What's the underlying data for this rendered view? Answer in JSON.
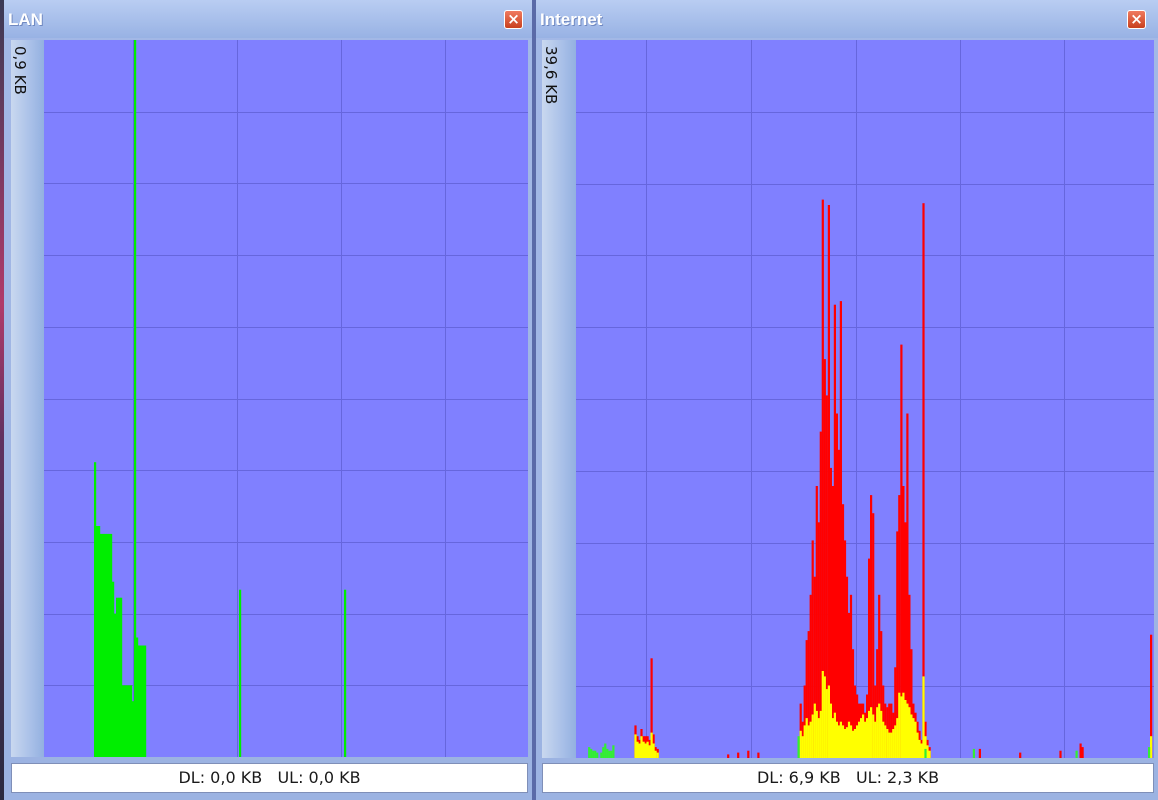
{
  "colors": {
    "graph_bg": "#8080ff",
    "grid": "#6666dd",
    "lan_trace": "#00ee00",
    "download": "#ff0000",
    "upload": "#ffff00",
    "overlap": "#33ee33"
  },
  "panels": [
    {
      "id": "lan",
      "title": "LAN",
      "scale_label": "0,9 KB",
      "dl_label": "DL:",
      "dl_value": "0,0 KB",
      "ul_label": "UL:",
      "ul_value": "0,0 KB",
      "close_icon": "close-x-icon"
    },
    {
      "id": "inet",
      "title": "Internet",
      "scale_label": "39,6 KB",
      "dl_label": "DL:",
      "dl_value": "6,9 KB",
      "ul_label": "UL:",
      "ul_value": "2,3 KB",
      "close_icon": "close-x-icon"
    }
  ],
  "chart_data": [
    {
      "type": "bar",
      "panel": "lan",
      "ylim": [
        0,
        0.9
      ],
      "xlim": [
        0,
        480
      ],
      "series": [
        {
          "color_key": "lan_trace",
          "points": [
            [
              50,
              0.37
            ],
            [
              52,
              0.29
            ],
            [
              54,
              0.29
            ],
            [
              56,
              0.28
            ],
            [
              58,
              0.28
            ],
            [
              60,
              0.28
            ],
            [
              62,
              0.28
            ],
            [
              64,
              0.28
            ],
            [
              66,
              0.28
            ],
            [
              68,
              0.22
            ],
            [
              70,
              0.18
            ],
            [
              72,
              0.2
            ],
            [
              74,
              0.2
            ],
            [
              76,
              0.2
            ],
            [
              78,
              0.09
            ],
            [
              80,
              0.09
            ],
            [
              82,
              0.09
            ],
            [
              84,
              0.09
            ],
            [
              86,
              0.09
            ],
            [
              88,
              0.07
            ],
            [
              90,
              0.9
            ],
            [
              92,
              0.15
            ],
            [
              94,
              0.14
            ],
            [
              96,
              0.14
            ],
            [
              98,
              0.14
            ],
            [
              100,
              0.14
            ],
            [
              195,
              0.21
            ],
            [
              300,
              0.21
            ]
          ]
        }
      ]
    },
    {
      "type": "bar",
      "panel": "inet",
      "ylim": [
        0,
        39.6
      ],
      "xlim": [
        0,
        570
      ],
      "series": [
        {
          "name": "DL",
          "color_key": "download",
          "points": [
            [
              58,
              1.8
            ],
            [
              60,
              1.2
            ],
            [
              62,
              1.0
            ],
            [
              64,
              1.6
            ],
            [
              66,
              1.2
            ],
            [
              68,
              1.2
            ],
            [
              70,
              1.2
            ],
            [
              72,
              1.0
            ],
            [
              74,
              5.5
            ],
            [
              76,
              1.3
            ],
            [
              78,
              0.6
            ],
            [
              80,
              0.5
            ],
            [
              150,
              0.2
            ],
            [
              160,
              0.3
            ],
            [
              170,
              0.4
            ],
            [
              180,
              0.3
            ],
            [
              222,
              3.0
            ],
            [
              224,
              2.0
            ],
            [
              226,
              4.0
            ],
            [
              228,
              6.5
            ],
            [
              230,
              7.0
            ],
            [
              232,
              9.0
            ],
            [
              234,
              12.0
            ],
            [
              236,
              10.0
            ],
            [
              238,
              15.0
            ],
            [
              240,
              13.0
            ],
            [
              242,
              18.0
            ],
            [
              244,
              30.8
            ],
            [
              246,
              22.0
            ],
            [
              248,
              20.0
            ],
            [
              250,
              30.5
            ],
            [
              252,
              16.0
            ],
            [
              254,
              15.0
            ],
            [
              256,
              25.0
            ],
            [
              258,
              19.0
            ],
            [
              260,
              17.0
            ],
            [
              262,
              25.2
            ],
            [
              264,
              14.0
            ],
            [
              266,
              12.0
            ],
            [
              268,
              10.0
            ],
            [
              270,
              8.0
            ],
            [
              272,
              9.0
            ],
            [
              274,
              6.0
            ],
            [
              276,
              4.0
            ],
            [
              278,
              3.5
            ],
            [
              280,
              3.0
            ],
            [
              282,
              3.0
            ],
            [
              284,
              3.0
            ],
            [
              286,
              2.5
            ],
            [
              288,
              3.5
            ],
            [
              290,
              11.0
            ],
            [
              292,
              14.5
            ],
            [
              294,
              13.5
            ],
            [
              296,
              4.0
            ],
            [
              298,
              6.0
            ],
            [
              300,
              9.0
            ],
            [
              302,
              7.0
            ],
            [
              304,
              4.0
            ],
            [
              306,
              3.0
            ],
            [
              308,
              2.8
            ],
            [
              310,
              3.0
            ],
            [
              312,
              3.0
            ],
            [
              314,
              2.5
            ],
            [
              316,
              5.0
            ],
            [
              318,
              12.5
            ],
            [
              320,
              14.5
            ],
            [
              322,
              22.8
            ],
            [
              324,
              15.0
            ],
            [
              326,
              13.0
            ],
            [
              328,
              19.0
            ],
            [
              330,
              9.0
            ],
            [
              332,
              6.0
            ],
            [
              334,
              3.0
            ],
            [
              336,
              2.5
            ],
            [
              338,
              2.0
            ],
            [
              340,
              1.5
            ],
            [
              342,
              1.0
            ],
            [
              344,
              30.6
            ],
            [
              346,
              2.0
            ],
            [
              348,
              1.0
            ],
            [
              350,
              0.6
            ],
            [
              400,
              0.5
            ],
            [
              440,
              0.3
            ],
            [
              480,
              0.4
            ],
            [
              500,
              0.8
            ],
            [
              502,
              0.6
            ],
            [
              570,
              6.8
            ]
          ]
        },
        {
          "name": "UL",
          "color_key": "upload",
          "points": [
            [
              58,
              1.3
            ],
            [
              60,
              0.9
            ],
            [
              62,
              0.8
            ],
            [
              64,
              1.2
            ],
            [
              66,
              0.9
            ],
            [
              68,
              0.8
            ],
            [
              70,
              0.9
            ],
            [
              72,
              0.7
            ],
            [
              74,
              1.4
            ],
            [
              76,
              0.8
            ],
            [
              78,
              0.4
            ],
            [
              80,
              0.3
            ],
            [
              222,
              1.5
            ],
            [
              224,
              1.2
            ],
            [
              226,
              1.8
            ],
            [
              228,
              2.2
            ],
            [
              230,
              1.8
            ],
            [
              232,
              2.0
            ],
            [
              234,
              2.4
            ],
            [
              236,
              3.0
            ],
            [
              238,
              2.6
            ],
            [
              240,
              2.2
            ],
            [
              242,
              2.6
            ],
            [
              244,
              4.8
            ],
            [
              246,
              4.5
            ],
            [
              248,
              3.8
            ],
            [
              250,
              4.0
            ],
            [
              252,
              3.0
            ],
            [
              254,
              2.2
            ],
            [
              256,
              2.5
            ],
            [
              258,
              2.0
            ],
            [
              260,
              1.8
            ],
            [
              262,
              2.0
            ],
            [
              264,
              1.8
            ],
            [
              266,
              1.6
            ],
            [
              268,
              1.7
            ],
            [
              270,
              2.0
            ],
            [
              272,
              1.8
            ],
            [
              274,
              1.5
            ],
            [
              276,
              1.6
            ],
            [
              278,
              1.8
            ],
            [
              280,
              2.0
            ],
            [
              282,
              2.2
            ],
            [
              284,
              2.4
            ],
            [
              286,
              2.0
            ],
            [
              288,
              2.2
            ],
            [
              290,
              2.6
            ],
            [
              292,
              2.8
            ],
            [
              294,
              2.4
            ],
            [
              296,
              2.0
            ],
            [
              298,
              2.8
            ],
            [
              300,
              3.0
            ],
            [
              302,
              2.6
            ],
            [
              304,
              2.0
            ],
            [
              306,
              1.8
            ],
            [
              308,
              1.6
            ],
            [
              310,
              1.4
            ],
            [
              312,
              1.4
            ],
            [
              314,
              1.6
            ],
            [
              316,
              1.8
            ],
            [
              318,
              2.2
            ],
            [
              320,
              3.6
            ],
            [
              322,
              3.4
            ],
            [
              324,
              3.6
            ],
            [
              326,
              3.2
            ],
            [
              328,
              3.0
            ],
            [
              330,
              2.8
            ],
            [
              332,
              2.4
            ],
            [
              334,
              2.2
            ],
            [
              336,
              2.0
            ],
            [
              338,
              1.4
            ],
            [
              340,
              1.0
            ],
            [
              342,
              0.8
            ],
            [
              344,
              4.5
            ],
            [
              346,
              1.2
            ],
            [
              348,
              0.7
            ],
            [
              350,
              0.4
            ],
            [
              570,
              1.2
            ]
          ]
        },
        {
          "name": "overlap",
          "color_key": "overlap",
          "points": [
            [
              12,
              0.6
            ],
            [
              14,
              0.5
            ],
            [
              16,
              0.4
            ],
            [
              18,
              0.4
            ],
            [
              20,
              0.3
            ],
            [
              24,
              0.3
            ],
            [
              26,
              0.6
            ],
            [
              28,
              0.8
            ],
            [
              30,
              0.5
            ],
            [
              32,
              0.4
            ],
            [
              34,
              0.4
            ],
            [
              36,
              0.7
            ],
            [
              220,
              1.2
            ],
            [
              346,
              0.5
            ],
            [
              394,
              0.5
            ],
            [
              496,
              0.4
            ],
            [
              568,
              0.6
            ]
          ]
        }
      ]
    }
  ]
}
